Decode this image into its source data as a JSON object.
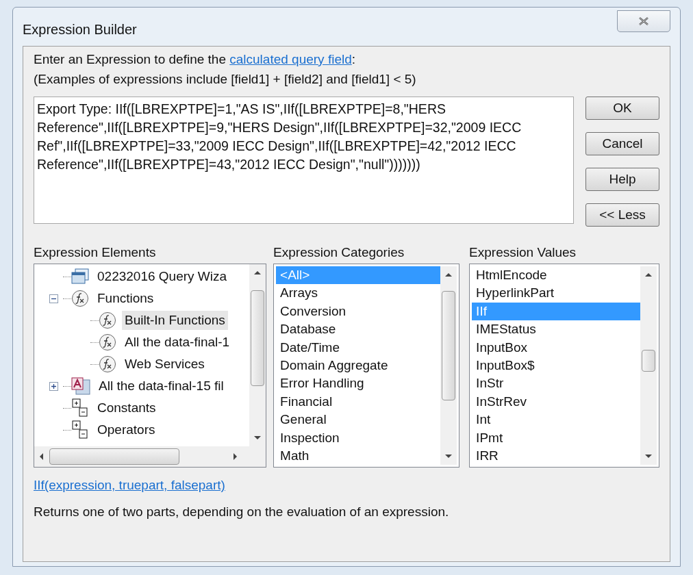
{
  "window": {
    "title": "Expression Builder"
  },
  "intro": {
    "text_before": "Enter an Expression to define the ",
    "link": "calculated query field",
    "text_after": ":"
  },
  "examples": "(Examples of expressions include [field1] + [field2] and [field1] < 5)",
  "expression": {
    "value": "Export Type: IIf([LBREXPTPE]=1,\"AS IS\",IIf([LBREXPTPE]=8,\"HERS Reference\",IIf([LBREXPTPE]=9,\"HERS Design\",IIf([LBREXPTPE]=32,\"2009 IECC Ref\",IIf([LBREXPTPE]=33,\"2009 IECC Design\",IIf([LBREXPTPE]=42,\"2012 IECC Reference\",IIf([LBREXPTPE]=43,\"2012 IECC Design\",\"null\")))))))"
  },
  "buttons": [
    "OK",
    "Cancel",
    "Help",
    "<< Less"
  ],
  "elements": {
    "heading": "Expression Elements",
    "items": [
      {
        "label": "02232016 Query Wiza",
        "kind": "query",
        "selected": false
      },
      {
        "label": "Functions",
        "kind": "function",
        "selected": false,
        "expanded": true,
        "children": [
          {
            "label": "Built-In Functions",
            "kind": "function",
            "selected": true
          },
          {
            "label": "All the data-final-1",
            "kind": "function",
            "selected": false
          },
          {
            "label": "Web Services",
            "kind": "function",
            "selected": false
          }
        ]
      },
      {
        "label": "All the data-final-15 fil",
        "kind": "database",
        "selected": false,
        "expanded": false
      },
      {
        "label": "Constants",
        "kind": "constants",
        "selected": false
      },
      {
        "label": "Operators",
        "kind": "constants",
        "selected": false
      }
    ]
  },
  "categories": {
    "heading": "Expression Categories",
    "items": [
      {
        "label": "<All>",
        "selected": true
      },
      {
        "label": "Arrays",
        "selected": false
      },
      {
        "label": "Conversion",
        "selected": false
      },
      {
        "label": "Database",
        "selected": false
      },
      {
        "label": "Date/Time",
        "selected": false
      },
      {
        "label": "Domain Aggregate",
        "selected": false
      },
      {
        "label": "Error Handling",
        "selected": false
      },
      {
        "label": "Financial",
        "selected": false
      },
      {
        "label": "General",
        "selected": false
      },
      {
        "label": "Inspection",
        "selected": false
      },
      {
        "label": "Math",
        "selected": false
      }
    ]
  },
  "values": {
    "heading": "Expression Values",
    "items": [
      {
        "label": "HtmlEncode",
        "selected": false
      },
      {
        "label": "HyperlinkPart",
        "selected": false
      },
      {
        "label": "IIf",
        "selected": true
      },
      {
        "label": "IMEStatus",
        "selected": false
      },
      {
        "label": "InputBox",
        "selected": false
      },
      {
        "label": "InputBox$",
        "selected": false
      },
      {
        "label": "InStr",
        "selected": false
      },
      {
        "label": "InStrRev",
        "selected": false
      },
      {
        "label": "Int",
        "selected": false
      },
      {
        "label": "IPmt",
        "selected": false
      },
      {
        "label": "IRR",
        "selected": false
      }
    ]
  },
  "syntax": "IIf(expression, truepart, falsepart)",
  "description": "Returns one of two parts, depending on the evaluation of an expression."
}
